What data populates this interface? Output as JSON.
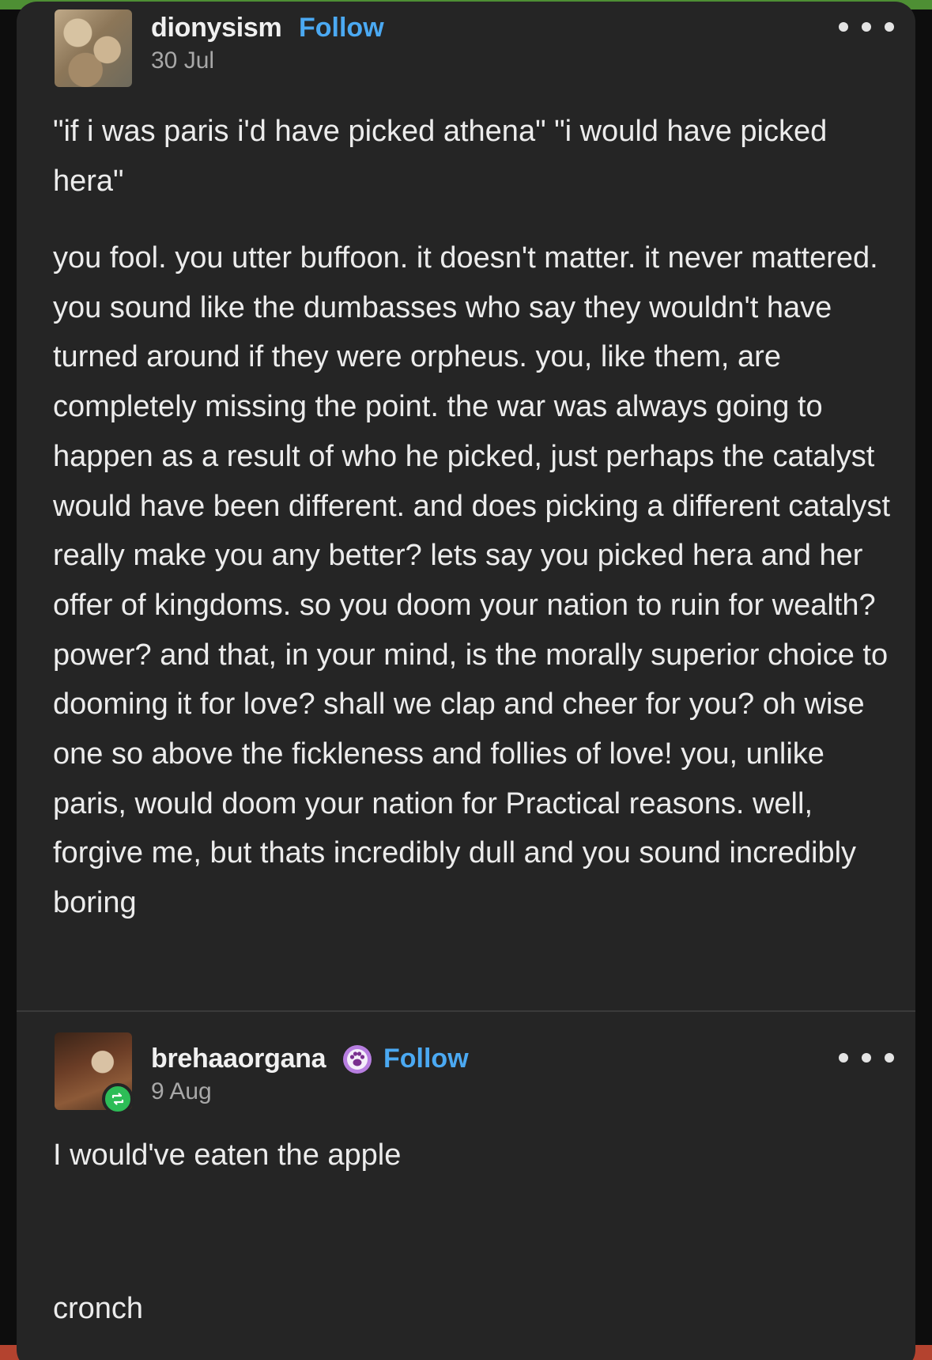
{
  "post_1": {
    "username": "dionysism",
    "follow_label": "Follow",
    "date": "30 Jul",
    "paragraph_1": "\"if i was paris i'd have picked athena\" \"i would have picked hera\"",
    "paragraph_2": "you fool. you utter buffoon. it doesn't matter. it never mattered. you sound like the dumbasses who say they wouldn't have turned around if they were orpheus. you, like them, are completely missing the point. the war was always going to happen as a result of who he picked, just perhaps the catalyst would have been different. and does picking a different catalyst really make you any better? lets say you picked hera and her offer of kingdoms. so you doom your nation to ruin for wealth? power? and that, in your mind, is the morally superior choice to dooming it for love? shall we clap and cheer for you? oh wise one so above the fickleness and follies of love! you, unlike paris, would doom your nation for Practical reasons. well, forgive me, but thats incredibly dull and you sound incredibly boring"
  },
  "post_2": {
    "username": "brehaaorgana",
    "follow_label": "Follow",
    "date": "9 Aug",
    "badge_icon": "paw-badge-icon",
    "reblog_icon": "reblog-icon",
    "paragraph_1": "I would've eaten the apple",
    "paragraph_2": "cronch"
  },
  "colors": {
    "card_background": "#252525",
    "follow_link": "#4ba9f2",
    "reblog_badge": "#2dbd57",
    "paw_badge": "#b77ee0"
  }
}
